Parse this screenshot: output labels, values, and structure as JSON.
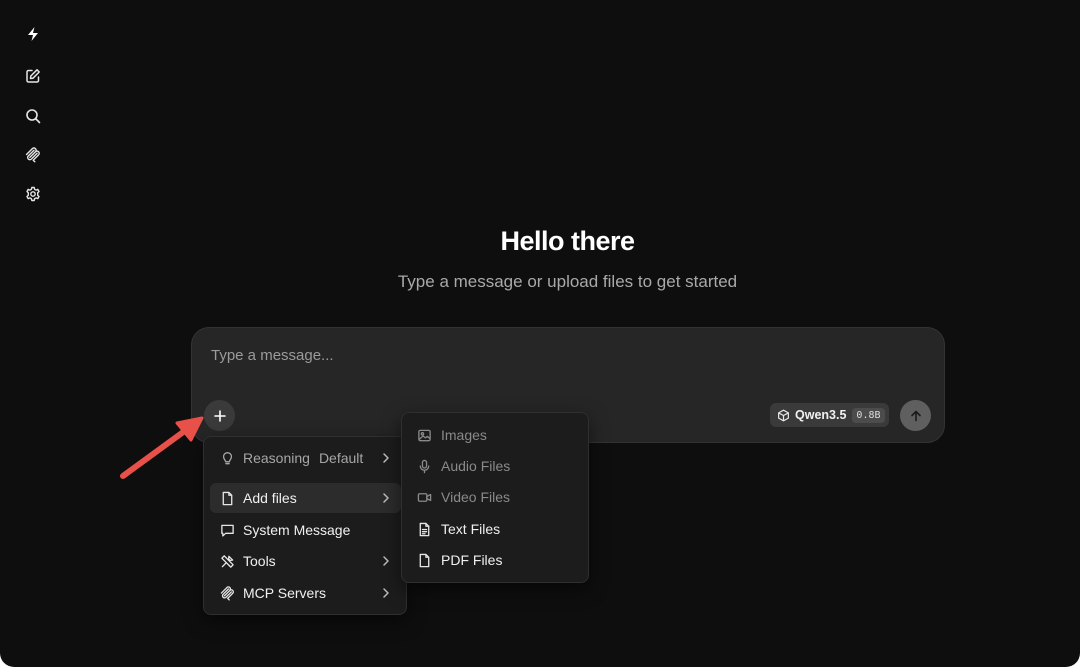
{
  "rail": {
    "items": [
      {
        "name": "logo",
        "icon": "bolt-logo-icon"
      },
      {
        "name": "new-chat",
        "icon": "edit-icon"
      },
      {
        "name": "search",
        "icon": "search-icon"
      },
      {
        "name": "mcp",
        "icon": "mcp-icon"
      },
      {
        "name": "settings",
        "icon": "gear-icon"
      }
    ]
  },
  "hero": {
    "title": "Hello there",
    "subtitle": "Type a message or upload files to get started"
  },
  "composer": {
    "placeholder": "Type a message...",
    "value": "",
    "model": {
      "name": "Qwen3.5",
      "size": "0.8B"
    }
  },
  "menu": {
    "items": [
      {
        "label": "Reasoning",
        "value": "Default",
        "icon": "lightbulb-icon",
        "has_submenu": true
      },
      {
        "label": "Add files",
        "icon": "file-icon",
        "has_submenu": true,
        "active": true
      },
      {
        "label": "System Message",
        "icon": "message-icon",
        "has_submenu": false
      },
      {
        "label": "Tools",
        "icon": "tools-icon",
        "has_submenu": true
      },
      {
        "label": "MCP Servers",
        "icon": "mcp-icon",
        "has_submenu": true
      }
    ]
  },
  "submenu": {
    "items": [
      {
        "label": "Images",
        "icon": "image-icon",
        "enabled": false
      },
      {
        "label": "Audio Files",
        "icon": "mic-icon",
        "enabled": false
      },
      {
        "label": "Video Files",
        "icon": "video-icon",
        "enabled": false
      },
      {
        "label": "Text Files",
        "icon": "text-file-icon",
        "enabled": true
      },
      {
        "label": "PDF Files",
        "icon": "file-icon",
        "enabled": true
      }
    ]
  },
  "colors": {
    "background": "#0e0e0e",
    "composer": "#262626",
    "menu": "#1c1c1c",
    "annotation_arrow": "#e8504a"
  }
}
